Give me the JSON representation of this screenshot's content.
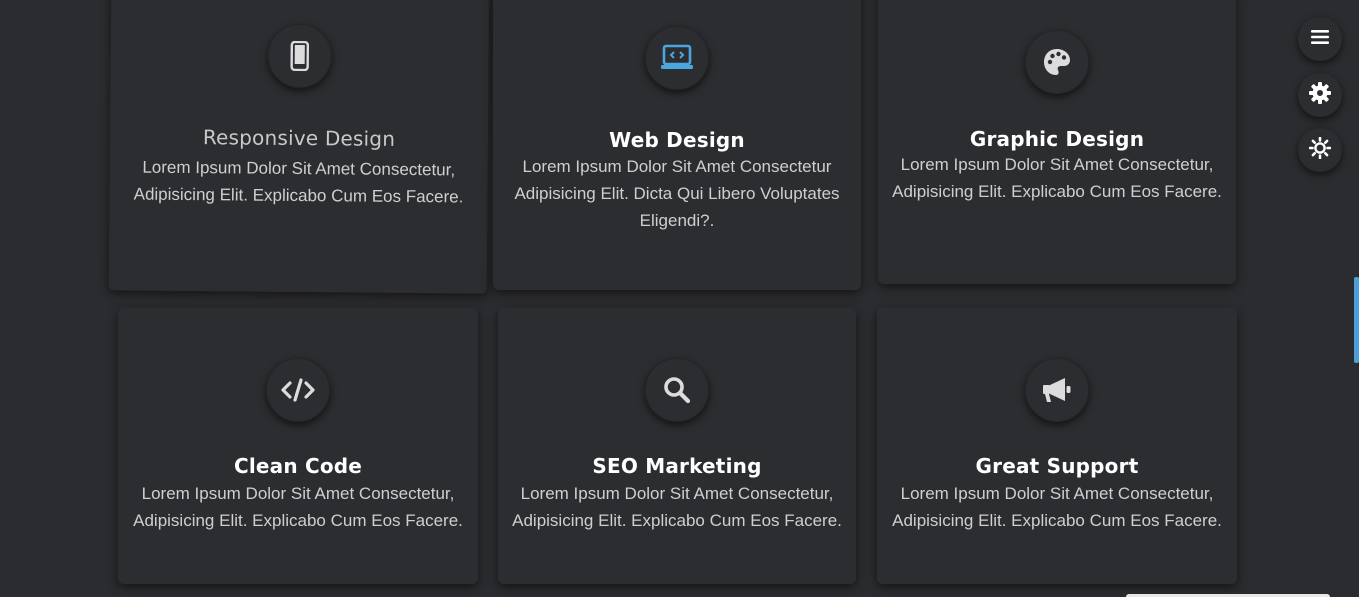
{
  "accent_color": "#4aa6e0",
  "services": [
    {
      "title": "Responsive Design",
      "text": "Lorem Ipsum Dolor Sit Amet Consectetur, Adipisicing Elit. Explicabo Cum Eos Facere.",
      "icon": "mobile-icon"
    },
    {
      "title": "Web Design",
      "text": "Lorem Ipsum Dolor Sit Amet Consectetur Adipisicing Elit. Dicta Qui Libero Voluptates Eligendi?.",
      "icon": "laptop-code-icon"
    },
    {
      "title": "Graphic Design",
      "text": "Lorem Ipsum Dolor Sit Amet Consectetur, Adipisicing Elit. Explicabo Cum Eos Facere.",
      "icon": "palette-icon"
    },
    {
      "title": "Clean Code",
      "text": "Lorem Ipsum Dolor Sit Amet Consectetur, Adipisicing Elit. Explicabo Cum Eos Facere.",
      "icon": "code-icon"
    },
    {
      "title": "SEO Marketing",
      "text": "Lorem Ipsum Dolor Sit Amet Consectetur, Adipisicing Elit. Explicabo Cum Eos Facere.",
      "icon": "search-icon"
    },
    {
      "title": "Great Support",
      "text": "Lorem Ipsum Dolor Sit Amet Consectetur, Adipisicing Elit. Explicabo Cum Eos Facere.",
      "icon": "bullhorn-icon"
    }
  ],
  "side_controls": [
    {
      "icon": "menu-icon"
    },
    {
      "icon": "gear-icon"
    },
    {
      "icon": "sun-icon"
    }
  ]
}
